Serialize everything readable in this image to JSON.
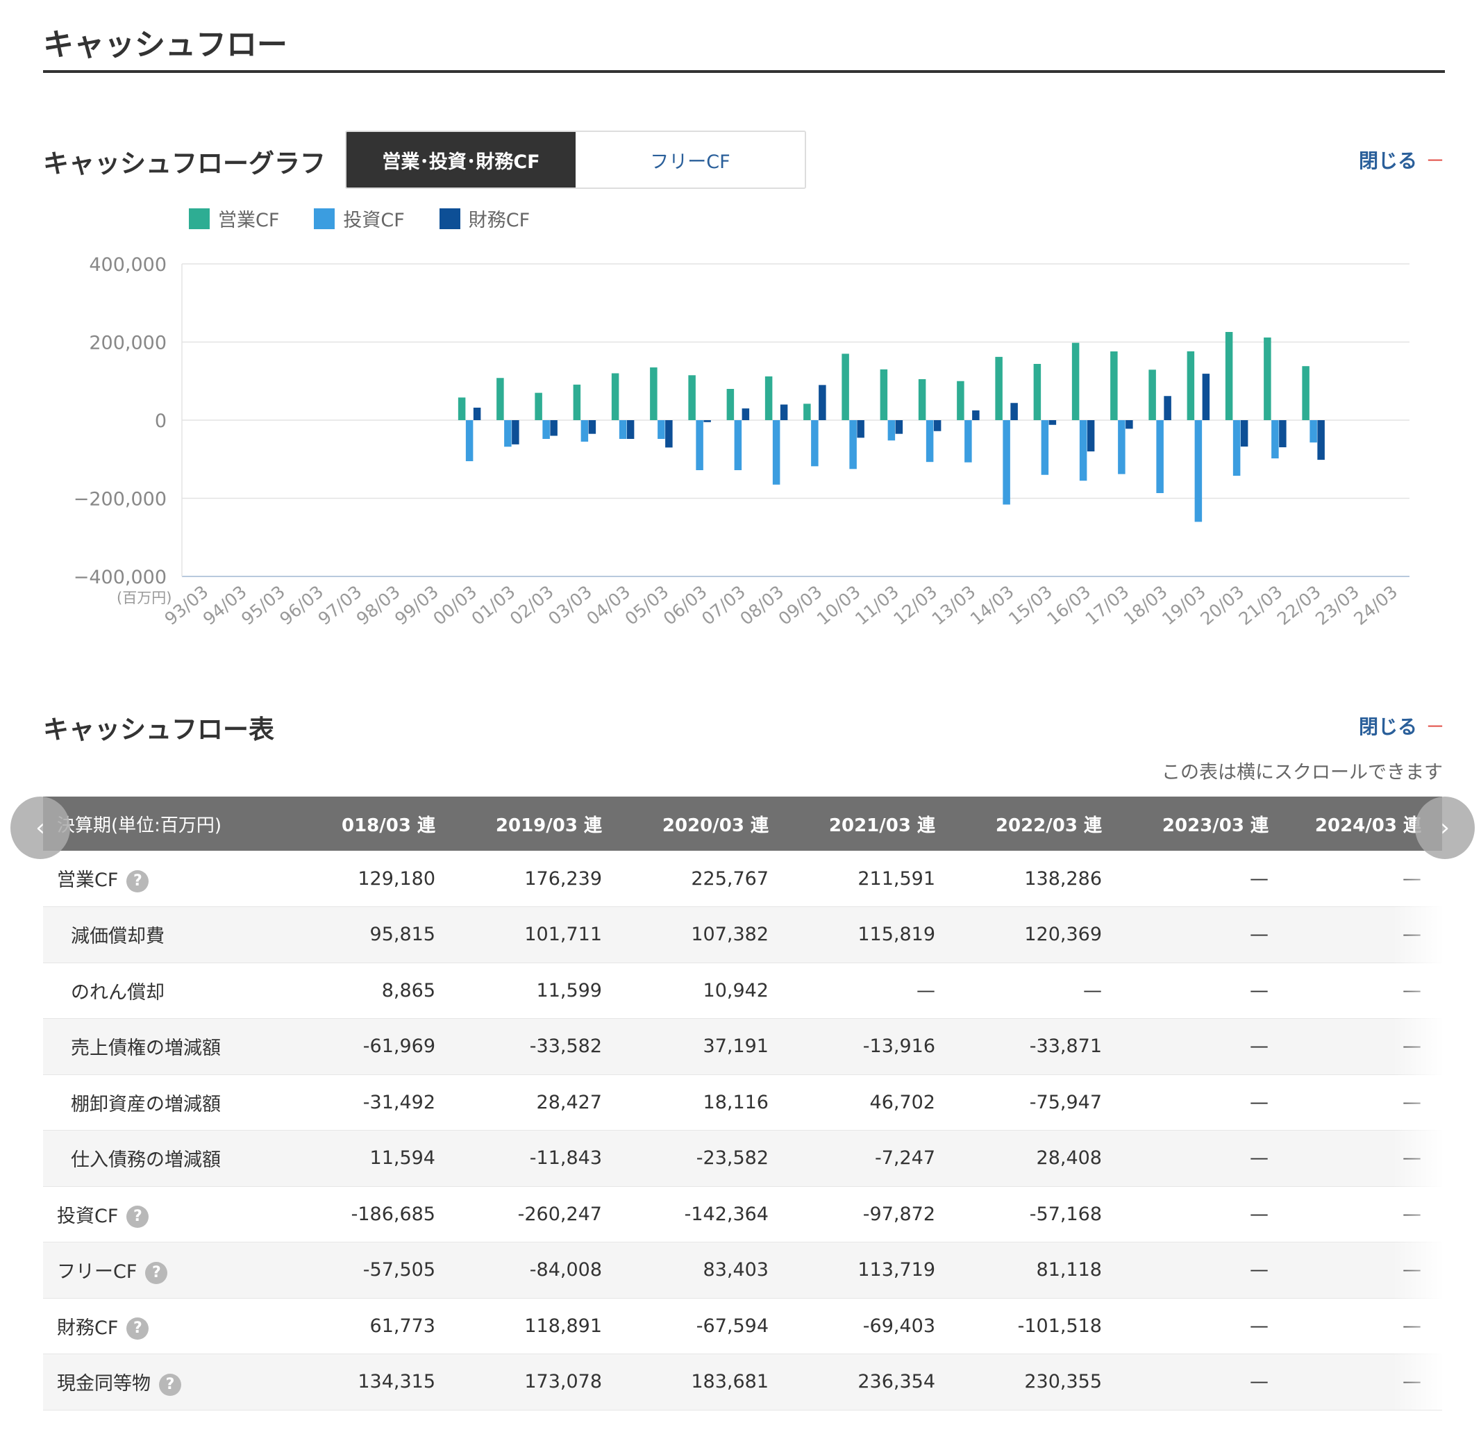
{
  "page_title": "キャッシュフロー",
  "graph_section": {
    "title": "キャッシュフローグラフ",
    "close_label": "閉じる",
    "close_dash": "－",
    "tabs": [
      {
        "label": "営業･投資･財務CF",
        "active": true
      },
      {
        "label": "フリーCF",
        "active": false
      }
    ]
  },
  "table_section": {
    "title": "キャッシュフロー表",
    "close_label": "閉じる",
    "close_dash": "－",
    "scroll_note": "この表は横にスクロールできます",
    "scroll_left_icon": "‹",
    "scroll_right_icon": "›"
  },
  "colors": {
    "operating": "#2ead93",
    "investing": "#3b9de0",
    "financing": "#0d4f96"
  },
  "chart_data": {
    "type": "bar",
    "unit_label": "(百万円)",
    "ylim": [
      -400000,
      400000
    ],
    "yticks": [
      400000,
      200000,
      0,
      -200000,
      -400000
    ],
    "ytick_labels": [
      "400,000",
      "200,000",
      "0",
      "−200,000",
      "−400,000"
    ],
    "categories": [
      "93/03",
      "94/03",
      "95/03",
      "96/03",
      "97/03",
      "98/03",
      "99/03",
      "00/03",
      "01/03",
      "02/03",
      "03/03",
      "04/03",
      "05/03",
      "06/03",
      "07/03",
      "08/03",
      "09/03",
      "10/03",
      "11/03",
      "12/03",
      "13/03",
      "14/03",
      "15/03",
      "16/03",
      "17/03",
      "18/03",
      "19/03",
      "20/03",
      "21/03",
      "22/03",
      "23/03",
      "24/03"
    ],
    "grid": true,
    "legend_position": "top-left",
    "series": [
      {
        "name": "営業CF",
        "values": [
          null,
          null,
          null,
          null,
          null,
          null,
          null,
          58000,
          108000,
          70000,
          91000,
          120000,
          135000,
          115000,
          80000,
          112000,
          42000,
          170000,
          130000,
          105000,
          100000,
          162000,
          144000,
          198000,
          176000,
          129180,
          176239,
          225767,
          211591,
          138286,
          null,
          null
        ]
      },
      {
        "name": "投資CF",
        "values": [
          null,
          null,
          null,
          null,
          null,
          null,
          null,
          -105000,
          -68000,
          -48000,
          -55000,
          -48000,
          -48000,
          -128000,
          -128000,
          -165000,
          -118000,
          -125000,
          -52000,
          -107000,
          -108000,
          -216000,
          -140000,
          -155000,
          -138000,
          -186685,
          -260247,
          -142364,
          -97872,
          -57168,
          null,
          null
        ]
      },
      {
        "name": "財務CF",
        "values": [
          null,
          null,
          null,
          null,
          null,
          null,
          null,
          32000,
          -62000,
          -40000,
          -35000,
          -48000,
          -70000,
          -5000,
          30000,
          40000,
          90000,
          -45000,
          -35000,
          -28000,
          25000,
          44000,
          -12000,
          -80000,
          -22000,
          61773,
          118891,
          -67594,
          -69403,
          -101518,
          null,
          null
        ]
      }
    ]
  },
  "table": {
    "header_label": "決算期(単位:百万円)",
    "columns": [
      "018/03 連",
      "2019/03 連",
      "2020/03 連",
      "2021/03 連",
      "2022/03 連",
      "2023/03 連",
      "2024/03 連"
    ],
    "rows": [
      {
        "label": "営業CF",
        "help": "?",
        "values": [
          "129,180",
          "176,239",
          "225,767",
          "211,591",
          "138,286",
          "—",
          "—"
        ]
      },
      {
        "label": "減価償却費",
        "values": [
          "95,815",
          "101,711",
          "107,382",
          "115,819",
          "120,369",
          "—",
          "—"
        ]
      },
      {
        "label": "のれん償却",
        "values": [
          "8,865",
          "11,599",
          "10,942",
          "—",
          "—",
          "—",
          "—"
        ]
      },
      {
        "label": "売上債権の増減額",
        "values": [
          "-61,969",
          "-33,582",
          "37,191",
          "-13,916",
          "-33,871",
          "—",
          "—"
        ]
      },
      {
        "label": "棚卸資産の増減額",
        "values": [
          "-31,492",
          "28,427",
          "18,116",
          "46,702",
          "-75,947",
          "—",
          "—"
        ]
      },
      {
        "label": "仕入債務の増減額",
        "values": [
          "11,594",
          "-11,843",
          "-23,582",
          "-7,247",
          "28,408",
          "—",
          "—"
        ]
      },
      {
        "label": "投資CF",
        "help": "?",
        "values": [
          "-186,685",
          "-260,247",
          "-142,364",
          "-97,872",
          "-57,168",
          "—",
          "—"
        ]
      },
      {
        "label": "フリーCF",
        "help": "?",
        "values": [
          "-57,505",
          "-84,008",
          "83,403",
          "113,719",
          "81,118",
          "—",
          "—"
        ]
      },
      {
        "label": "財務CF",
        "help": "?",
        "values": [
          "61,773",
          "118,891",
          "-67,594",
          "-69,403",
          "-101,518",
          "—",
          "—"
        ]
      },
      {
        "label": "現金同等物",
        "help": "?",
        "values": [
          "134,315",
          "173,078",
          "183,681",
          "236,354",
          "230,355",
          "—",
          "—"
        ]
      }
    ]
  }
}
